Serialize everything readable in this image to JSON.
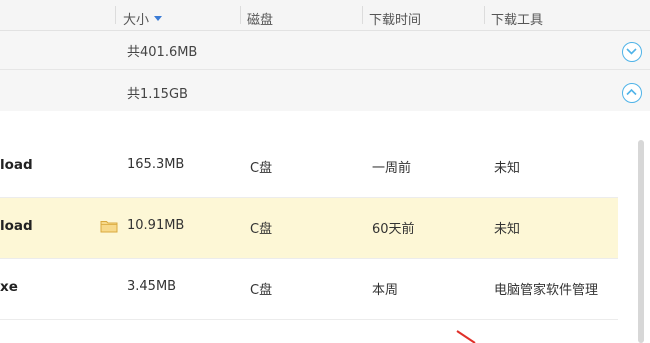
{
  "header": {
    "col_size": "大小",
    "col_disk": "磁盘",
    "col_time": "下载时间",
    "col_tool": "下载工具"
  },
  "groups": [
    {
      "total": "共401.6MB",
      "toggle_icon": "chevron-down-icon"
    },
    {
      "total": "共1.15GB",
      "toggle_icon": "chevron-up-icon"
    }
  ],
  "files": [
    {
      "name": "load",
      "size": "165.3MB",
      "disk": "C盘",
      "time": "一周前",
      "tool": "未知",
      "highlighted": false
    },
    {
      "name": "load",
      "size": "10.91MB",
      "disk": "C盘",
      "time": "60天前",
      "tool": "未知",
      "highlighted": true,
      "icon": "folder-icon"
    },
    {
      "name": "xe",
      "size": "3.45MB",
      "disk": "C盘",
      "time": "本周",
      "tool": "电脑管家软件管理",
      "highlighted": false
    }
  ],
  "colors": {
    "accent": "#3a7bd5",
    "toggle": "#4fb3e8",
    "highlight_row": "#fdf7d6",
    "folder": "#f2c86a"
  }
}
